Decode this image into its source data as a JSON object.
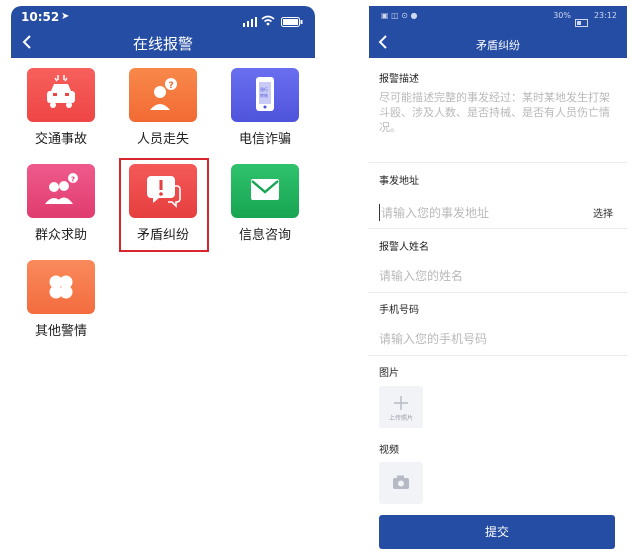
{
  "left_phone": {
    "status": {
      "time": "10:52"
    },
    "title": "在线报警",
    "categories": [
      {
        "label": "交通事故",
        "icon": "car-crash-icon",
        "color": "#f0504f"
      },
      {
        "label": "人员走失",
        "icon": "missing-person-icon",
        "color": "#f5793e"
      },
      {
        "label": "电信诈骗",
        "icon": "phone-fraud-icon",
        "color": "#5d63e6"
      },
      {
        "label": "群众求助",
        "icon": "crowd-help-icon",
        "color": "#e6467d"
      },
      {
        "label": "矛盾纠纷",
        "icon": "dispute-icon",
        "color": "#ee4b4b"
      },
      {
        "label": "信息咨询",
        "icon": "mail-icon",
        "color": "#22b560"
      },
      {
        "label": "其他警情",
        "icon": "clover-icon",
        "color": "#f77a4c"
      }
    ],
    "phone_icon_text": "银行\n转账"
  },
  "right_phone": {
    "status": {
      "battery": "30%",
      "time": "23:12"
    },
    "title": "矛盾纠纷",
    "desc_label": "报警描述",
    "desc_placeholder": "尽可能描述完整的事发经过：某时某地发生打架斗殴、涉及人数、是否持械、是否有人员伤亡情况。",
    "addr_label": "事发地址",
    "addr_placeholder": "请输入您的事发地址",
    "addr_select": "选择",
    "name_label": "报警人姓名",
    "name_placeholder": "请输入您的姓名",
    "phone_label": "手机号码",
    "phone_placeholder": "请输入您的手机号码",
    "image_label": "图片",
    "image_upload": "上传照片",
    "video_label": "视频",
    "submit": "提交"
  },
  "colors": {
    "header": "#254da3",
    "highlight": "#d8262c"
  }
}
